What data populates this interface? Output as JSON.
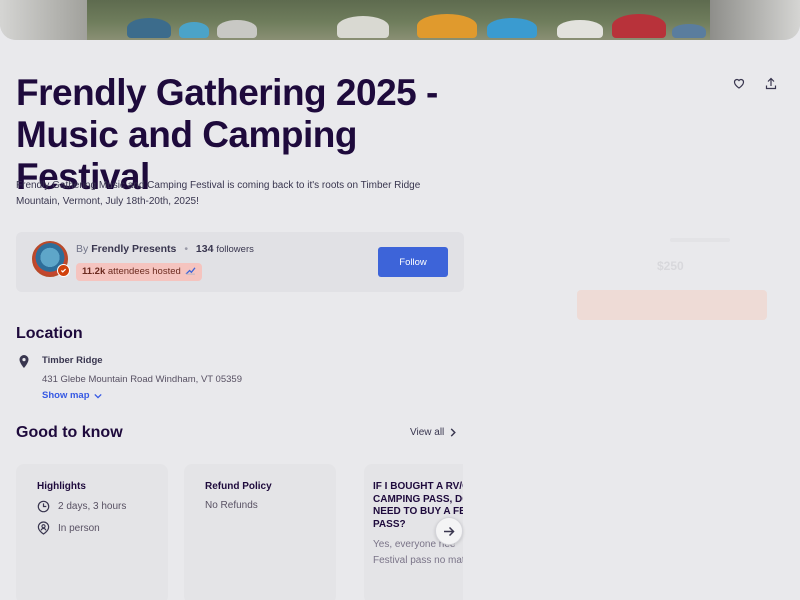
{
  "event": {
    "title": "Frendly Gathering 2025 - Music and Camping Festival",
    "summary": "Frendly Gathering Music and Camping Festival is coming back to it's roots on Timber Ridge Mountain, Vermont, July 18th-20th, 2025!"
  },
  "actions": {
    "like_icon": "heart-icon",
    "share_icon": "share-icon"
  },
  "organizer": {
    "by_label": "By",
    "name": "Frendly Presents",
    "followers_count": "134",
    "followers_label": "followers",
    "hosted_count": "11.2k",
    "hosted_label": "attendees hosted",
    "follow_label": "Follow"
  },
  "checkout": {
    "price": "$250"
  },
  "location": {
    "heading": "Location",
    "venue": "Timber Ridge",
    "address": "431 Glebe Mountain Road Windham, VT 05359",
    "show_map_label": "Show map"
  },
  "good_to_know": {
    "heading": "Good to know",
    "view_all_label": "View all",
    "highlights": {
      "title": "Highlights",
      "duration": "2 days, 3 hours",
      "format": "In person"
    },
    "refund": {
      "title": "Refund Policy",
      "text": "No Refunds"
    },
    "faq": {
      "title_line1": "IF I BOUGHT A RV/C",
      "title_line2": "CAMPING PASS, DO",
      "title_line3": "NEED TO BUY A FES",
      "title_line4": "PASS?",
      "answer_line1": "Yes, everyone nee",
      "answer_line2": "Festival pass no mat"
    }
  },
  "colors": {
    "title": "#1e0a3c",
    "follow_button": "#3d64d9",
    "link": "#3659e3",
    "badge": "#f5c4bf"
  }
}
